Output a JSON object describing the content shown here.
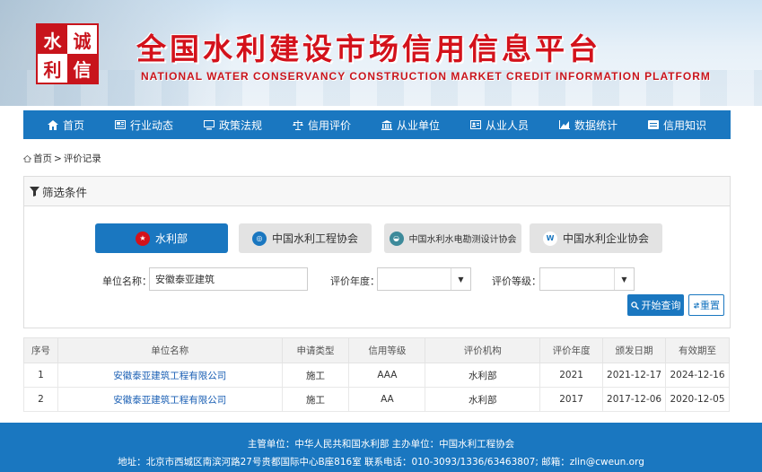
{
  "header": {
    "logo_chars": [
      "水",
      "诚",
      "利",
      "信"
    ],
    "title": "全国水利建设市场信用信息平台",
    "subtitle": "NATIONAL WATER CONSERVANCY CONSTRUCTION MARKET CREDIT INFORMATION PLATFORM"
  },
  "nav": {
    "items": [
      {
        "label": "首页",
        "icon": "home-icon"
      },
      {
        "label": "行业动态",
        "icon": "newspaper-icon"
      },
      {
        "label": "政策法规",
        "icon": "monitor-icon"
      },
      {
        "label": "信用评价",
        "icon": "scale-icon"
      },
      {
        "label": "从业单位",
        "icon": "bank-icon"
      },
      {
        "label": "从业人员",
        "icon": "id-card-icon"
      },
      {
        "label": "数据统计",
        "icon": "chart-icon"
      },
      {
        "label": "信用知识",
        "icon": "card-icon"
      }
    ]
  },
  "breadcrumb": {
    "home": "首页",
    "separator": ">",
    "current": "评价记录"
  },
  "filter": {
    "title": "筛选条件",
    "orgs": [
      {
        "label": "水利部",
        "active": true
      },
      {
        "label": "中国水利工程协会",
        "active": false
      },
      {
        "label": "中国水利水电勘测设计协会",
        "active": false
      },
      {
        "label": "中国水利企业协会",
        "active": false
      }
    ],
    "unit_label": "单位名称：",
    "unit_value": "安徽泰亚建筑",
    "year_label": "评价年度：",
    "year_value": "",
    "grade_label": "评价等级：",
    "grade_value": "",
    "search_label": "开始查询",
    "reset_label": "重置"
  },
  "table": {
    "headers": [
      "序号",
      "单位名称",
      "申请类型",
      "信用等级",
      "评价机构",
      "评价年度",
      "颁发日期",
      "有效期至"
    ],
    "rows": [
      [
        "1",
        "安徽泰亚建筑工程有限公司",
        "施工",
        "AAA",
        "水利部",
        "2021",
        "2021-12-17",
        "2024-12-16"
      ],
      [
        "2",
        "安徽泰亚建筑工程有限公司",
        "施工",
        "AA",
        "水利部",
        "2017",
        "2017-12-06",
        "2020-12-05"
      ]
    ]
  },
  "footer": {
    "line1": "主管单位：中华人民共和国水利部  主办单位：中国水利工程协会",
    "line2": "地址：北京市西城区南滨河路27号贵都国际中心B座816室  联系电话：010-3093/1336/63463807; 邮箱：zlin@cweun.org"
  },
  "colors": {
    "primary": "#1a77c0",
    "title_red": "#d3121b",
    "link": "#1a5fb4"
  }
}
